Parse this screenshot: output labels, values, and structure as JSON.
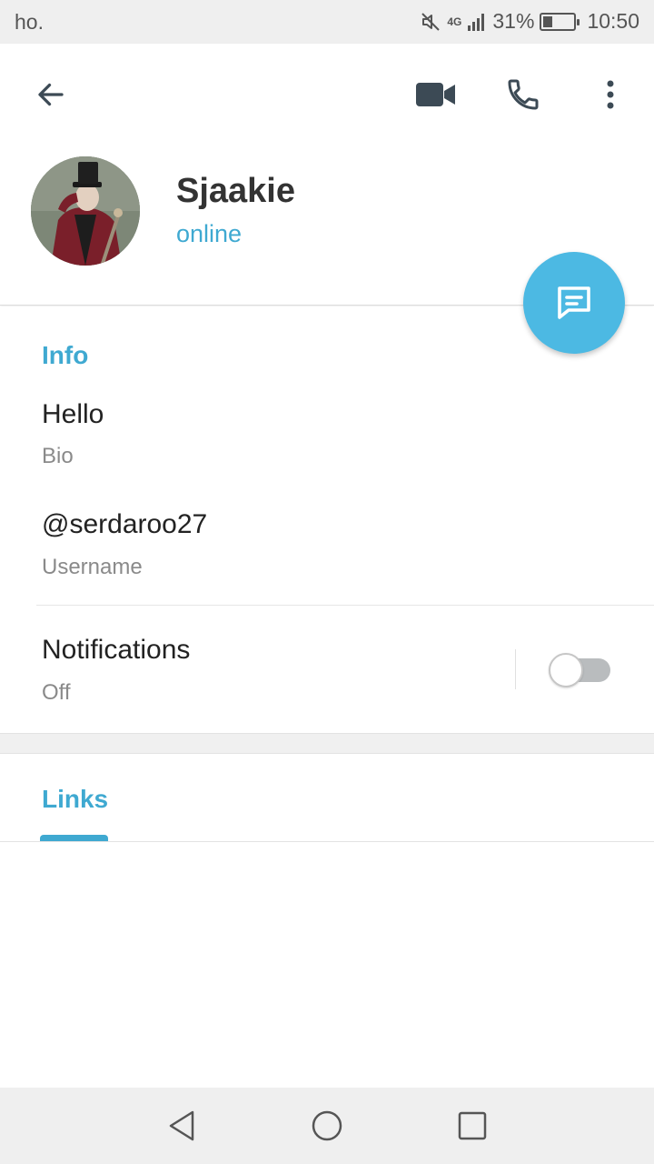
{
  "status_bar": {
    "carrier": "ho.",
    "network": "4G",
    "battery": "31%",
    "battery_level": 0.31,
    "time": "10:50",
    "icons": [
      "mute-icon",
      "signal-icon",
      "battery-icon"
    ]
  },
  "toolbar": {
    "icons": [
      "back-arrow-icon",
      "video-call-icon",
      "phone-call-icon",
      "more-vertical-icon"
    ]
  },
  "profile": {
    "name": "Sjaakie",
    "status": "online"
  },
  "fab": {
    "icon": "message-icon"
  },
  "info": {
    "title": "Info",
    "bio_value": "Hello",
    "bio_label": "Bio",
    "username_value": "@serdaroo27",
    "username_label": "Username",
    "notifications_label": "Notifications",
    "notifications_value": "Off",
    "notifications_enabled": false
  },
  "tabs": {
    "items": [
      {
        "label": "Links",
        "active": true
      }
    ]
  },
  "nav_bar": {
    "icons": [
      "nav-back-icon",
      "nav-home-icon",
      "nav-recents-icon"
    ]
  },
  "colors": {
    "accent": "#3fa9d1",
    "fab": "#4cb9e3",
    "icon": "#3c4a55"
  }
}
